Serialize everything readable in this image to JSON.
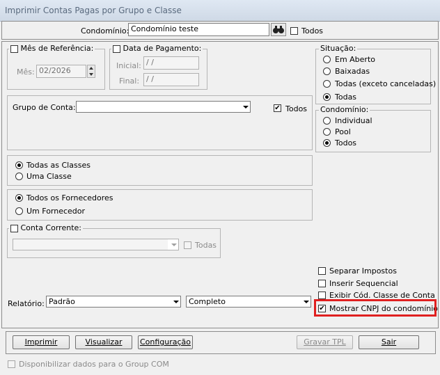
{
  "window": {
    "title": "Imprimir Contas Pagas por Grupo e Classe"
  },
  "condominio_row": {
    "label": "Condomínio:",
    "value": "Condomínio teste",
    "search_icon": "binoculars-icon",
    "todos_label": "Todos",
    "todos_checked": false
  },
  "mes_referencia": {
    "legend": "Mês de Referência:",
    "checked": false,
    "mes_label": "Mês:",
    "mes_value": "02/2026"
  },
  "data_pagamento": {
    "legend": "Data de Pagamento:",
    "checked": false,
    "inicial_label": "Inicial:",
    "inicial_value": " / /",
    "final_label": "Final:",
    "final_value": " / /"
  },
  "situacao": {
    "legend": "Situação:",
    "options": [
      "Em Aberto",
      "Baixadas",
      "Todas (exceto canceladas)",
      "Todas"
    ],
    "selected": "Todas"
  },
  "condominio_tipo": {
    "legend": "Condomínio:",
    "options": [
      "Individual",
      "Pool",
      "Todos"
    ],
    "selected": "Todos"
  },
  "grupo_conta": {
    "label": "Grupo de Conta:",
    "value": "",
    "todos_label": "Todos",
    "todos_checked": true
  },
  "classes": {
    "options": [
      "Todas as Classes",
      "Uma Classe"
    ],
    "selected": "Todas as Classes"
  },
  "fornecedores": {
    "options": [
      "Todos os Fornecedores",
      "Um Fornecedor"
    ],
    "selected": "Todos os Fornecedores"
  },
  "conta_corrente": {
    "legend": "Conta Corrente:",
    "checked": false,
    "value": "",
    "todas_label": "Todas",
    "todas_checked": false
  },
  "opcoes": {
    "separar_impostos": "Separar Impostos",
    "inserir_sequencial": "Inserir Sequencial",
    "exibir_cod_classe": "Exibir Cód. Classe de Conta",
    "mostrar_cnpj": "Mostrar CNPJ do condomínio",
    "mostrar_cnpj_checked": true
  },
  "relatorio": {
    "label": "Relatório:",
    "tipo": "Padrão",
    "formato": "Completo"
  },
  "buttons": {
    "imprimir": "Imprimir",
    "visualizar": "Visualizar",
    "configuracao": "Configuração",
    "gravar_tpl": "Gravar TPL",
    "sair": "Sair"
  },
  "footer": {
    "group_com": "Disponibilizar dados para o Group COM"
  },
  "colors": {
    "highlight": "#e02020",
    "background": "#f0f0f0"
  }
}
